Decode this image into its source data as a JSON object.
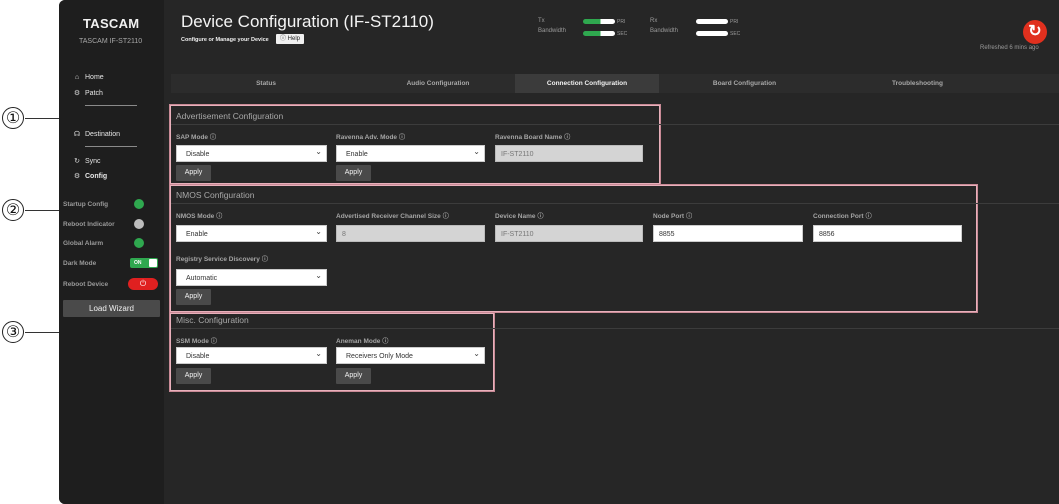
{
  "brand": {
    "name": "TASCAM",
    "device": "TASCAM IF-ST2110"
  },
  "nav": {
    "home": "Home",
    "patch": "Patch",
    "destination": "Destination",
    "sync": "Sync",
    "config": "Config"
  },
  "side": {
    "startup_config": "Startup Config",
    "reboot_indicator": "Reboot Indicator",
    "global_alarm": "Global Alarm",
    "dark_mode": "Dark Mode",
    "dark_mode_state": "ON",
    "reboot_device": "Reboot Device",
    "load_wizard": "Load Wizard"
  },
  "header": {
    "title": "Device Configuration (IF-ST2110)",
    "subtitle": "Configure or Manage your Device",
    "help": "Help",
    "tx": "Tx",
    "rx": "Rx",
    "bandwidth": "Bandwidth",
    "pri": "PRI",
    "sec": "SEC",
    "refreshed": "Refreshed 6 mins ago"
  },
  "tabs": [
    "Status",
    "Audio Configuration",
    "Connection Configuration",
    "Board Configuration",
    "Troubleshooting"
  ],
  "advertisement": {
    "title": "Advertisement Configuration",
    "sap_mode_label": "SAP Mode",
    "sap_mode_value": "Disable",
    "ravenna_adv_label": "Ravenna Adv. Mode",
    "ravenna_adv_value": "Enable",
    "ravenna_board_label": "Ravenna Board Name",
    "ravenna_board_value": "IF-ST2110",
    "apply": "Apply"
  },
  "nmos": {
    "title": "NMOS Configuration",
    "mode_label": "NMOS Mode",
    "mode_value": "Enable",
    "adv_receiver_label": "Advertised Receiver Channel Size",
    "adv_receiver_value": "8",
    "device_name_label": "Device Name",
    "device_name_value": "IF-ST2110",
    "node_port_label": "Node Port",
    "node_port_value": "8855",
    "connection_port_label": "Connection Port",
    "connection_port_value": "8856",
    "registry_label": "Registry Service Discovery",
    "registry_value": "Automatic",
    "apply": "Apply"
  },
  "misc": {
    "title": "Misc. Configuration",
    "ssm_label": "SSM Mode",
    "ssm_value": "Disable",
    "aneman_label": "Aneman Mode",
    "aneman_value": "Receivers Only Mode",
    "apply": "Apply"
  },
  "callouts": [
    "①",
    "②",
    "③"
  ],
  "colors": {
    "accent_green": "#2fa84f",
    "alarm_red": "#e02020",
    "callout_pink": "#e8b0bb"
  }
}
